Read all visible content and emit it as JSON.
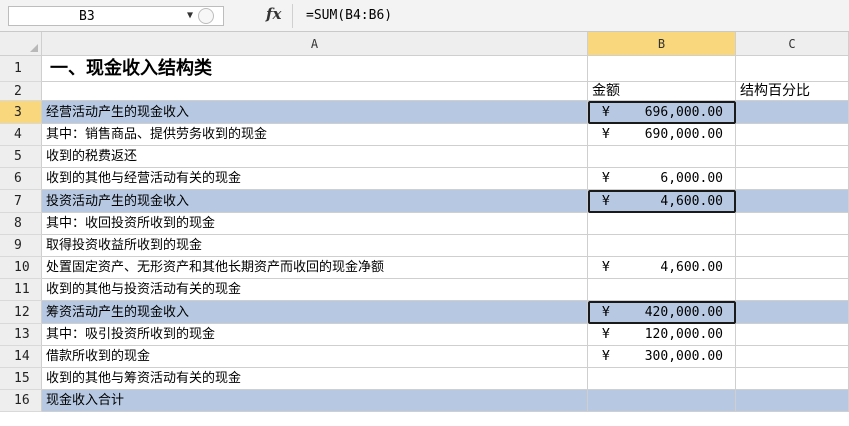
{
  "formula_bar": {
    "cell_ref": "B3",
    "fx_label": "fx",
    "formula": "=SUM(B4:B6)"
  },
  "columns": [
    {
      "id": "corner",
      "label": ""
    },
    {
      "id": "A",
      "label": "A"
    },
    {
      "id": "B",
      "label": "B"
    },
    {
      "id": "C",
      "label": "C"
    }
  ],
  "row_numbers": [
    "1",
    "2",
    "3",
    "4",
    "5",
    "6",
    "7",
    "8",
    "9",
    "10",
    "11",
    "12",
    "13",
    "14",
    "15",
    "16"
  ],
  "title": "一、现金收入结构类",
  "header_row": {
    "b_label": "金额",
    "c_label": "结构百分比"
  },
  "rows": [
    {
      "label": "经营活动产生的现金收入",
      "yen": "¥",
      "amount": "696,000.00"
    },
    {
      "label": "其中：销售商品、提供劳务收到的现金",
      "yen": "¥",
      "amount": "690,000.00"
    },
    {
      "label": "收到的税费返还",
      "yen": "",
      "amount": ""
    },
    {
      "label": "收到的其他与经营活动有关的现金",
      "yen": "¥",
      "amount": "6,000.00"
    },
    {
      "label": "投资活动产生的现金收入",
      "yen": "¥",
      "amount": "4,600.00"
    },
    {
      "label": "其中：收回投资所收到的现金",
      "yen": "",
      "amount": ""
    },
    {
      "label": "取得投资收益所收到的现金",
      "yen": "",
      "amount": ""
    },
    {
      "label": "处置固定资产、无形资产和其他长期资产而收回的现金净额",
      "yen": "¥",
      "amount": "4,600.00"
    },
    {
      "label": "收到的其他与投资活动有关的现金",
      "yen": "",
      "amount": ""
    },
    {
      "label": "筹资活动产生的现金收入",
      "yen": "¥",
      "amount": "420,000.00"
    },
    {
      "label": "其中：吸引投资所收到的现金",
      "yen": "¥",
      "amount": "120,000.00"
    },
    {
      "label": "借款所收到的现金",
      "yen": "¥",
      "amount": "300,000.00"
    },
    {
      "label": "收到的其他与筹资活动有关的现金",
      "yen": "",
      "amount": ""
    },
    {
      "label": "现金收入合计",
      "yen": "",
      "amount": ""
    }
  ],
  "colors": {
    "band": "#b7c9e2",
    "selected_header": "#f9d77d",
    "header_bg": "#eeeeee"
  }
}
